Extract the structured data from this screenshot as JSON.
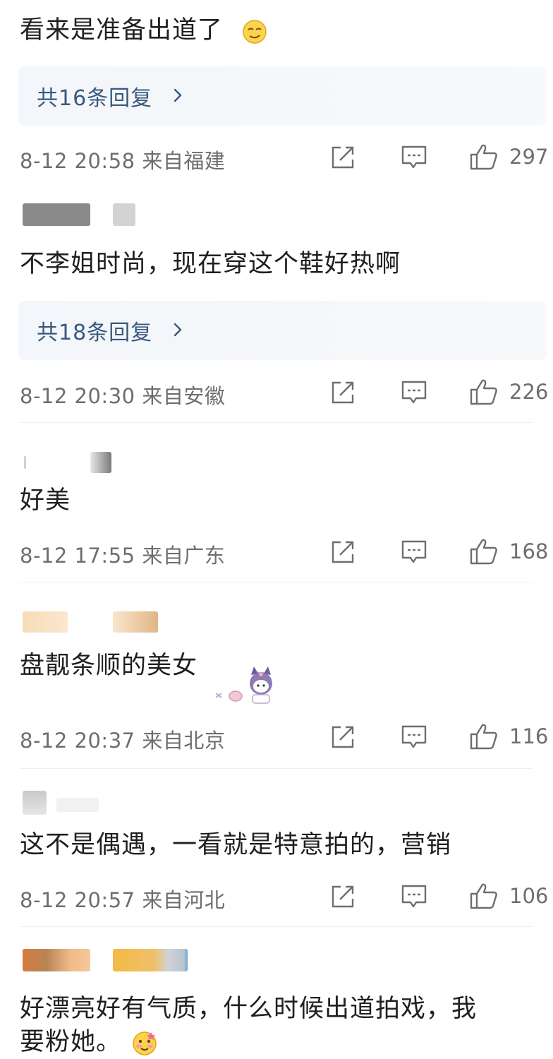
{
  "comments": [
    {
      "text": "看来是准备出道了",
      "replies_label": "共16条回复",
      "meta": "8-12 20:58 来自福建",
      "likes": "297"
    },
    {
      "text": "不李姐时尚，现在穿这个鞋好热啊",
      "replies_label": "共18条回复",
      "meta": "8-12 20:30 来自安徽",
      "likes": "226"
    },
    {
      "text": "好美",
      "meta": "8-12 17:55 来自广东",
      "likes": "168"
    },
    {
      "text": "盘靓条顺的美女",
      "meta": "8-12 20:37 来自北京",
      "likes": "116"
    },
    {
      "text": "这不是偶遇，一看就是特意拍的，营销",
      "meta": "8-12 20:57 来自河北",
      "likes": "106"
    },
    {
      "text_line1": "好漂亮好有气质，什么时候出道拍戏，我",
      "text_line2": "要粉她。"
    }
  ],
  "icons": {
    "share": "share-icon",
    "comment": "comment-icon",
    "like": "thumbs-up-icon",
    "chevron": "chevron-right-icon"
  },
  "colors": {
    "reply_link": "#37597d",
    "meta_text": "#6e6e6e",
    "reply_bg": "#f3f6fa"
  }
}
